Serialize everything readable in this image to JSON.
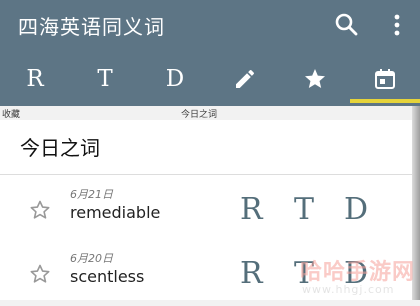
{
  "app": {
    "title": "四海英语同义词"
  },
  "toolbar": {
    "search_icon": "search-icon",
    "more_icon": "more-vert-icon"
  },
  "tabs": [
    {
      "label": "R",
      "kind": "letter"
    },
    {
      "label": "T",
      "kind": "letter"
    },
    {
      "label": "D",
      "kind": "letter"
    },
    {
      "icon": "pencil-icon",
      "kind": "icon"
    },
    {
      "icon": "star-icon",
      "kind": "icon"
    },
    {
      "icon": "calendar-today-icon",
      "kind": "icon",
      "selected": true
    }
  ],
  "strip": {
    "left": "收藏",
    "center": "今日之词"
  },
  "section": {
    "title": "今日之词"
  },
  "entries": [
    {
      "date": "6月21日",
      "word": "remediable",
      "r": "R",
      "t": "T",
      "d": "D",
      "starred": false
    },
    {
      "date": "6月20日",
      "word": "scentless",
      "r": "R",
      "t": "T",
      "d": "D",
      "starred": false
    }
  ],
  "watermark": {
    "main": "哈哈手游网",
    "url": "www.hhgj.com"
  },
  "colors": {
    "app_bar": "#5d7585",
    "tab_indicator": "#e5d33a",
    "rtd_letters": "#546e7a",
    "background": "#f2f2f2"
  }
}
